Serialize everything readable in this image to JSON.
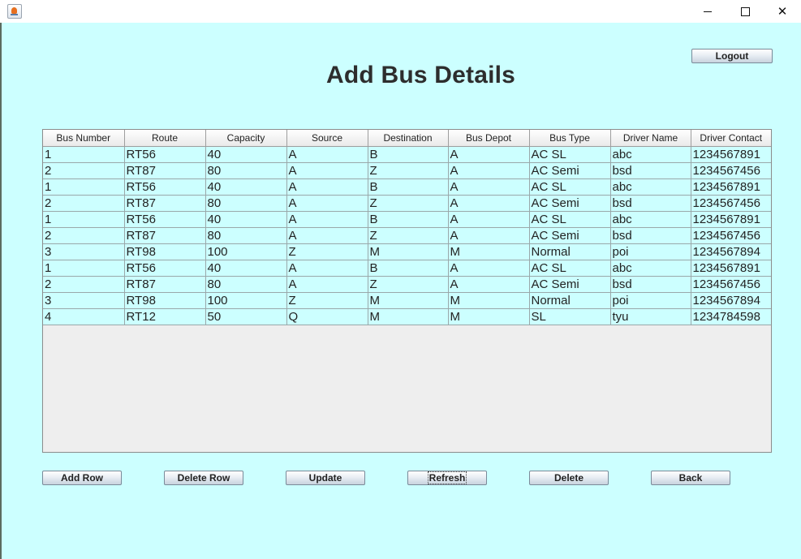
{
  "window": {
    "minimize_glyph": "",
    "maximize_glyph": "",
    "close_glyph": "✕"
  },
  "header": {
    "title": "Add Bus Details",
    "logout_label": "Logout"
  },
  "table": {
    "columns": [
      "Bus Number",
      "Route",
      "Capacity",
      "Source",
      "Destination",
      "Bus Depot",
      "Bus Type",
      "Driver Name",
      "Driver Contact"
    ],
    "rows": [
      [
        "1",
        "RT56",
        "40",
        "A",
        "B",
        "A",
        "AC SL",
        "abc",
        "1234567891"
      ],
      [
        "2",
        "RT87",
        "80",
        "A",
        "Z",
        "A",
        "AC Semi",
        "bsd",
        "1234567456"
      ],
      [
        "1",
        "RT56",
        "40",
        "A",
        "B",
        "A",
        "AC SL",
        "abc",
        "1234567891"
      ],
      [
        "2",
        "RT87",
        "80",
        "A",
        "Z",
        "A",
        "AC Semi",
        "bsd",
        "1234567456"
      ],
      [
        "1",
        "RT56",
        "40",
        "A",
        "B",
        "A",
        "AC SL",
        "abc",
        "1234567891"
      ],
      [
        "2",
        "RT87",
        "80",
        "A",
        "Z",
        "A",
        "AC Semi",
        "bsd",
        "1234567456"
      ],
      [
        "3",
        "RT98",
        "100",
        "Z",
        "M",
        "M",
        "Normal",
        "poi",
        "1234567894"
      ],
      [
        "1",
        "RT56",
        "40",
        "A",
        "B",
        "A",
        "AC SL",
        "abc",
        "1234567891"
      ],
      [
        "2",
        "RT87",
        "80",
        "A",
        "Z",
        "A",
        "AC Semi",
        "bsd",
        "1234567456"
      ],
      [
        "3",
        "RT98",
        "100",
        "Z",
        "M",
        "M",
        "Normal",
        "poi",
        "1234567894"
      ],
      [
        "4",
        "RT12",
        "50",
        "Q",
        "M",
        "M",
        "SL",
        "tyu",
        "1234784598"
      ]
    ]
  },
  "actions": {
    "add_row": "Add Row",
    "delete_row": "Delete Row",
    "update": "Update",
    "refresh": "Refresh",
    "delete": "Delete",
    "back": "Back"
  },
  "colors": {
    "background": "#ccffff",
    "grid_empty": "#eeeeee",
    "title_text": "#2d2d2d"
  }
}
